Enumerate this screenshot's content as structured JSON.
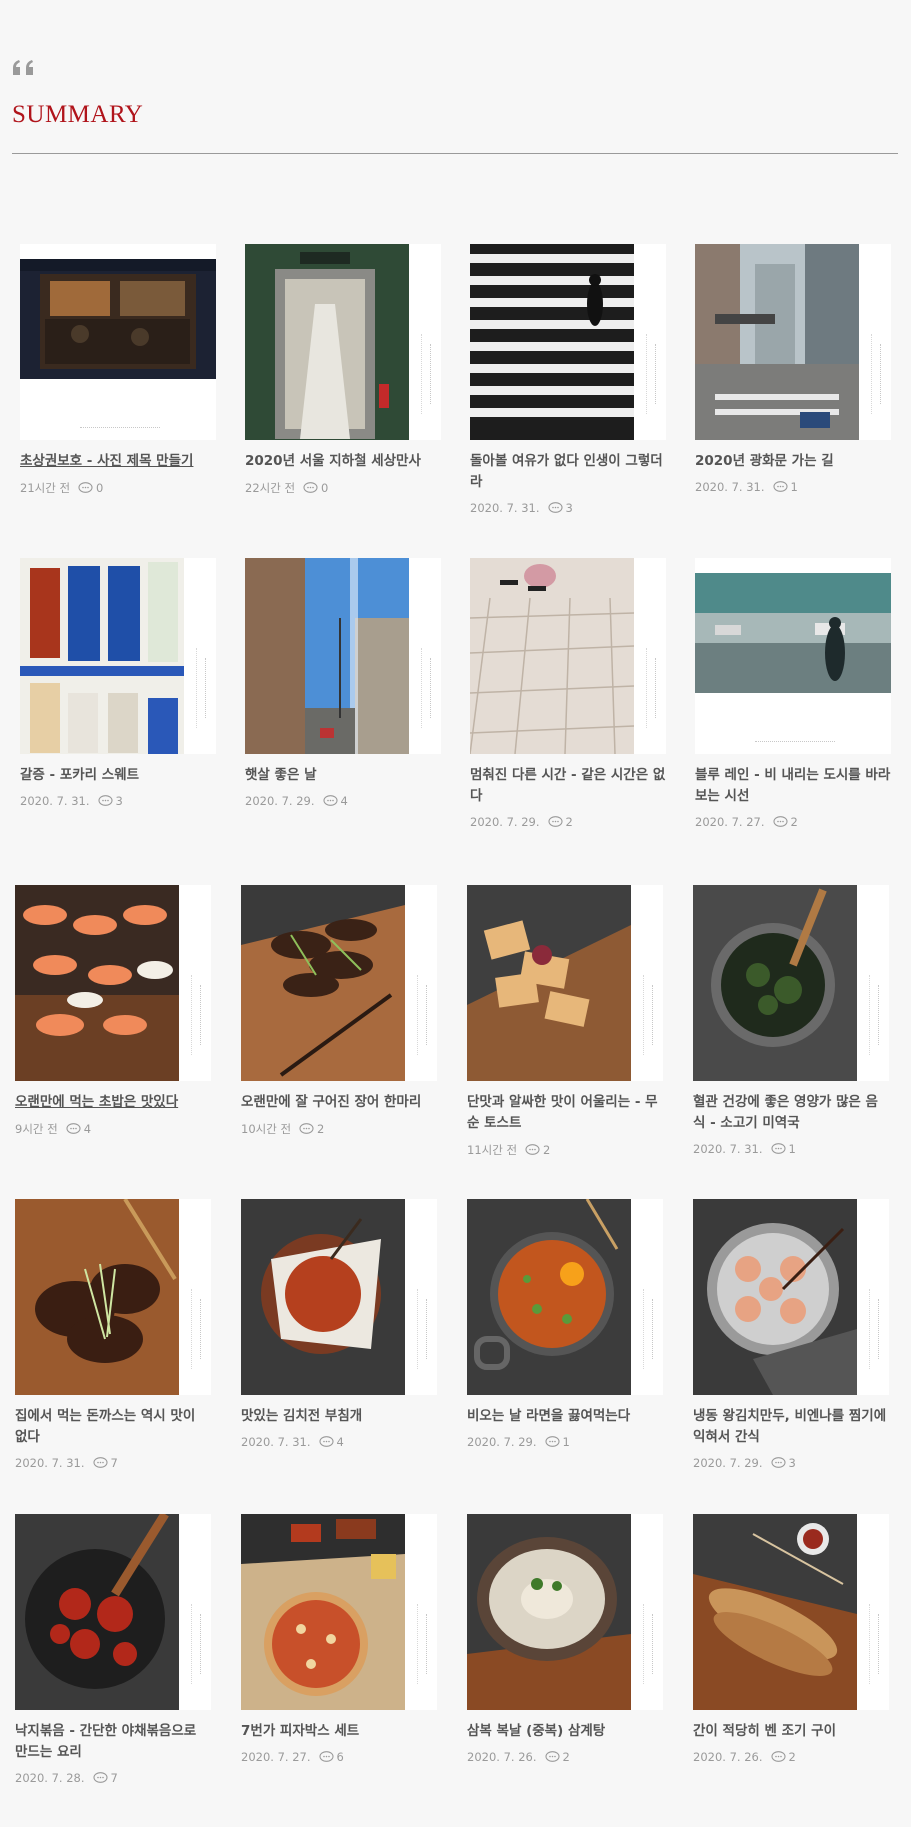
{
  "section": {
    "title": "SUMMARY",
    "icon": "quote-icon"
  },
  "icons": {
    "comment": "comment-icon"
  },
  "posts": [
    {
      "title": "초상권보호 - 사진 제목 만들기",
      "date": "21시간 전",
      "comments": "0"
    },
    {
      "title": "2020년 서울 지하철 세상만사",
      "date": "22시간 전",
      "comments": "0"
    },
    {
      "title": "돌아볼 여유가 없다 인생이 그렇더라",
      "date": "2020. 7. 31.",
      "comments": "3"
    },
    {
      "title": "2020년 광화문 가는 길",
      "date": "2020. 7. 31.",
      "comments": "1"
    },
    {
      "title": "갈증 - 포카리 스웨트",
      "date": "2020. 7. 31.",
      "comments": "3"
    },
    {
      "title": "햇살 좋은 날",
      "date": "2020. 7. 29.",
      "comments": "4"
    },
    {
      "title": "멈춰진 다른 시간 - 같은 시간은 없다",
      "date": "2020. 7. 29.",
      "comments": "2"
    },
    {
      "title": "블루 레인 - 비 내리는 도시를 바라보는 시선",
      "date": "2020. 7. 27.",
      "comments": "2"
    },
    {
      "title": "오랜만에 먹는 초밥은 맛있다",
      "date": "9시간 전",
      "comments": "4"
    },
    {
      "title": "오랜만에 잘 구어진 장어 한마리",
      "date": "10시간 전",
      "comments": "2"
    },
    {
      "title": "단맛과 알싸한 맛이 어울리는 - 무순 토스트",
      "date": "11시간 전",
      "comments": "2"
    },
    {
      "title": "혈관 건강에 좋은 영양가 많은 음식 - 소고기 미역국",
      "date": "2020. 7. 31.",
      "comments": "1"
    },
    {
      "title": "집에서 먹는 돈까스는 역시 맛이 없다",
      "date": "2020. 7. 31.",
      "comments": "7"
    },
    {
      "title": "맛있는 김치전 부침개",
      "date": "2020. 7. 31.",
      "comments": "4"
    },
    {
      "title": "비오는 날 라면을 끓여먹는다",
      "date": "2020. 7. 29.",
      "comments": "1"
    },
    {
      "title": "냉동 왕김치만두, 비엔나를 찜기에 익혀서 간식",
      "date": "2020. 7. 29.",
      "comments": "3"
    },
    {
      "title": "낙지볶음 - 간단한 야채볶음으로 만드는 요리",
      "date": "2020. 7. 28.",
      "comments": "7"
    },
    {
      "title": "7번가 피자박스 세트",
      "date": "2020. 7. 27.",
      "comments": "6"
    },
    {
      "title": "삼복 복날 (중복) 삼계탕",
      "date": "2020. 7. 26.",
      "comments": "2"
    },
    {
      "title": "간이 적당히 벤 조기 구이",
      "date": "2020. 7. 26.",
      "comments": "2"
    }
  ]
}
